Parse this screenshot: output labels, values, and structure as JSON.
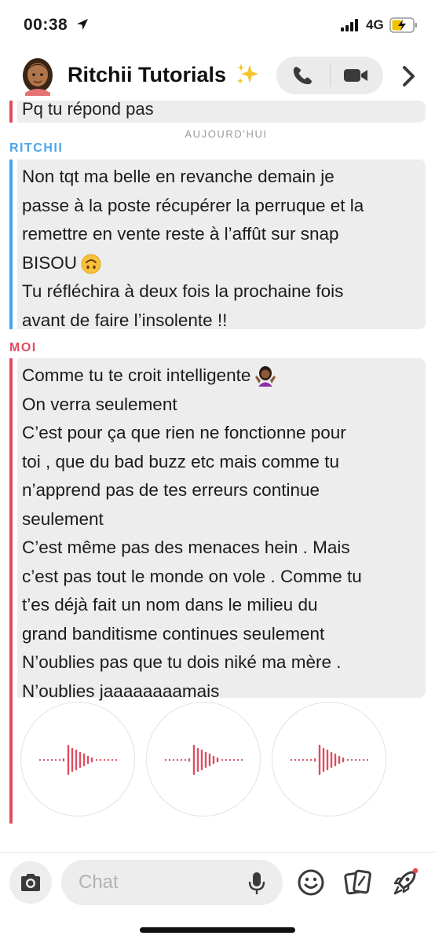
{
  "status": {
    "time": "00:38",
    "network": "4G",
    "icons": [
      "location-arrow-icon",
      "signal-bars-icon",
      "battery-charging-icon"
    ]
  },
  "header": {
    "title": "Ritchii Tutorials",
    "icons": [
      "avatar",
      "sparkles-icon",
      "phone-icon",
      "video-camera-icon",
      "chevron-right-icon"
    ]
  },
  "messages": {
    "previous": "Pq tu répond pas",
    "day_separator": "AUJOURD'HUI",
    "ritchii": {
      "sender": "RITCHII",
      "lines": [
        "Non tqt ma belle en revanche demain je",
        "passe à la poste récupérer la perruque et la",
        "remettre en vente reste à l’affût sur snap",
        "BISOU",
        "Tu réfléchira à deux fois la prochaine fois",
        "avant de faire l’insolente !!"
      ]
    },
    "moi": {
      "sender": "MOI",
      "lines": [
        "Comme tu te croit intelligente",
        "On verra seulement",
        "C’est pour ça que rien ne fonctionne pour",
        "toi , que du bad buzz etc mais comme tu",
        "n’apprend pas de tes erreurs continue",
        "seulement",
        "C’est même pas des menaces hein . Mais",
        "c’est pas tout le monde on vole . Comme tu",
        "t’es déjà fait un nom dans le milieu du",
        "grand banditisme continues seulement",
        "N’oublies pas que tu dois niké ma mère .",
        "N’oublies jaaaaaaaamais"
      ],
      "voice_notes": 3
    }
  },
  "composer": {
    "placeholder": "Chat",
    "icons": [
      "camera-icon",
      "microphone-icon",
      "smiley-icon",
      "cards-icon",
      "rocket-icon"
    ]
  },
  "colors": {
    "accent_red": "#e04c60",
    "accent_blue": "#4aa5ee",
    "bubble": "#ededed",
    "muted": "#9a9a9a"
  }
}
